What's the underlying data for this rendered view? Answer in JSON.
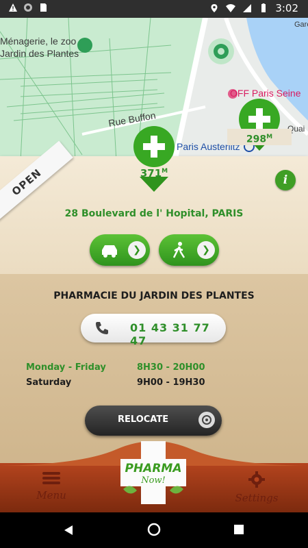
{
  "status_bar": {
    "time": "3:02"
  },
  "map": {
    "labels": {
      "zoo_line1": "Ménagerie, le zoo",
      "zoo_line2": "Jardin des Plantes",
      "street": "Rue Buffon",
      "seine": "OFF Paris Seine",
      "station": "Paris Austerlitz",
      "quai": "Quai d",
      "edge": "Gare"
    },
    "pins": [
      {
        "distance": "371",
        "unit": "M"
      },
      {
        "distance": "298",
        "unit": "M"
      }
    ]
  },
  "panel": {
    "status": "OPEN",
    "info_label": "i",
    "address": "28 Boulevard de l' Hopital, PARIS"
  },
  "details": {
    "pharmacy_name": "PHARMACIE DU JARDIN DES PLANTES",
    "phone": "01 43 31 77 47",
    "hours": [
      {
        "days": "Monday - Friday",
        "time": "8H30 - 20H00"
      },
      {
        "days": "Saturday",
        "time": "9H00 - 19H30"
      }
    ],
    "relocate_label": "RELOCATE"
  },
  "bottom_bar": {
    "menu_label": "Menu",
    "settings_label": "Settings",
    "logo_line1": "PHARMA",
    "logo_line2": "Now!"
  },
  "colors": {
    "green": "#3f9e25",
    "wood": "#b4441e",
    "panel": "#f4ead7"
  }
}
